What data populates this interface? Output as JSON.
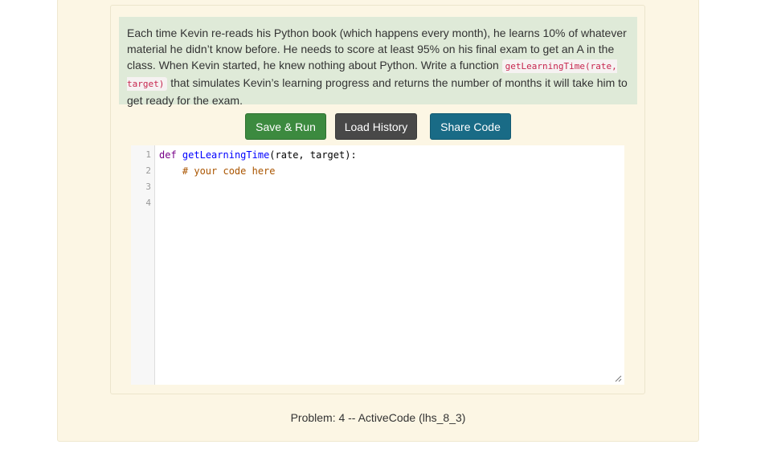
{
  "problem": {
    "text_before": "Each time Kevin re-reads his Python book (which happens every month), he learns 10% of whatever material he didn’t know before. He needs to score at least 95% on his final exam to get an A in the class. When Kevin started, he knew nothing about Python. Write a function ",
    "code": "getLearningTime(rate, target)",
    "text_after": " that simulates Kevin’s learning progress and returns the number of months it will take him to get ready for the exam."
  },
  "toolbar": {
    "save_label": "Save & Run",
    "history_label": "Load History",
    "share_label": "Share Code"
  },
  "editor": {
    "line_numbers": [
      "1",
      "2",
      "3",
      "4"
    ],
    "line1": {
      "keyword": "def",
      "func_name": "getLearningTime",
      "rest": "(rate, target):"
    },
    "line2": {
      "indent": "    ",
      "comment": "# your code here"
    }
  },
  "caption": "Problem: 4 -- ActiveCode (lhs_8_3)",
  "colors": {
    "page_bg": "#fcf6e4",
    "problem_bg": "#dfead8",
    "save_button": "#3c8a3f",
    "history_button": "#484848",
    "share_button": "#196b86"
  }
}
